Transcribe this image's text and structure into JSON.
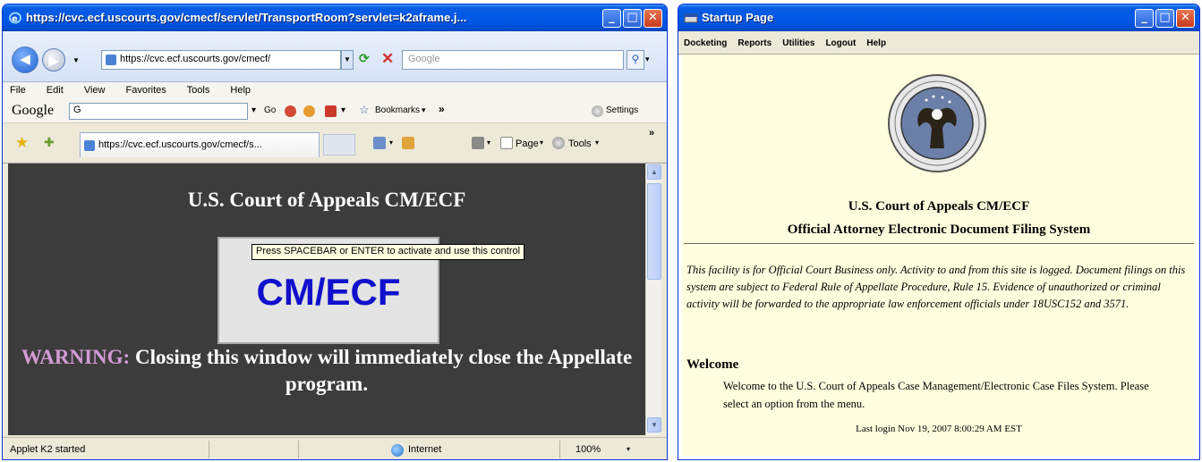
{
  "ie_window": {
    "title": "https://cvc.ecf.uscourts.gov/cmecf/servlet/TransportRoom?servlet=k2aframe.j...",
    "address": "https://cvc.ecf.uscourts.gov/cmecf/",
    "search_placeholder": "Google",
    "menu": [
      "File",
      "Edit",
      "View",
      "Favorites",
      "Tools",
      "Help"
    ],
    "google_toolbar": {
      "logo": "Google",
      "input_value": "G",
      "go_label": "Go",
      "bookmarks_label": "Bookmarks",
      "more_label": "»",
      "settings_label": "Settings"
    },
    "tab_label": "https://cvc.ecf.uscourts.gov/cmecf/s...",
    "commands": {
      "page": "Page",
      "tools": "Tools",
      "more": "»"
    },
    "content": {
      "heading": "U.S. Court of Appeals CM/ECF",
      "applet_label": "CM/ECF",
      "tooltip": "Press SPACEBAR or ENTER to activate and use this control",
      "warning_label": "WARNING:",
      "warning_text": " Closing this window will immediately close the Appellate program."
    },
    "status": {
      "text": "Applet K2 started",
      "zone": "Internet",
      "zoom": "100%"
    }
  },
  "startup_window": {
    "title": "Startup Page",
    "menu": [
      "Docketing",
      "Reports",
      "Utilities",
      "Logout",
      "Help"
    ],
    "title1": "U.S. Court of Appeals CM/ECF",
    "title2": "Official Attorney Electronic Document Filing System",
    "disclaimer": "This facility is for Official Court Business only. Activity to and from this site is logged. Document filings on this system are subject to Federal Rule of Appellate Procedure, Rule 15. Evidence of unauthorized or criminal activity will be forwarded to the appropriate law enforcement officials under 18USC152 and 3571.",
    "welcome_heading": "Welcome",
    "welcome_text": "Welcome to the U.S. Court of Appeals Case Management/Electronic Case Files System. Please select an option from the menu.",
    "last_login": "Last login Nov 19, 2007 8:00:29 AM EST"
  },
  "colors": {
    "titlebar": "#0058e6",
    "applet_text": "#1010cc",
    "warning": "#d39ad6",
    "content_bg": "#3c3c3c",
    "startup_bg": "#ffffdf"
  }
}
